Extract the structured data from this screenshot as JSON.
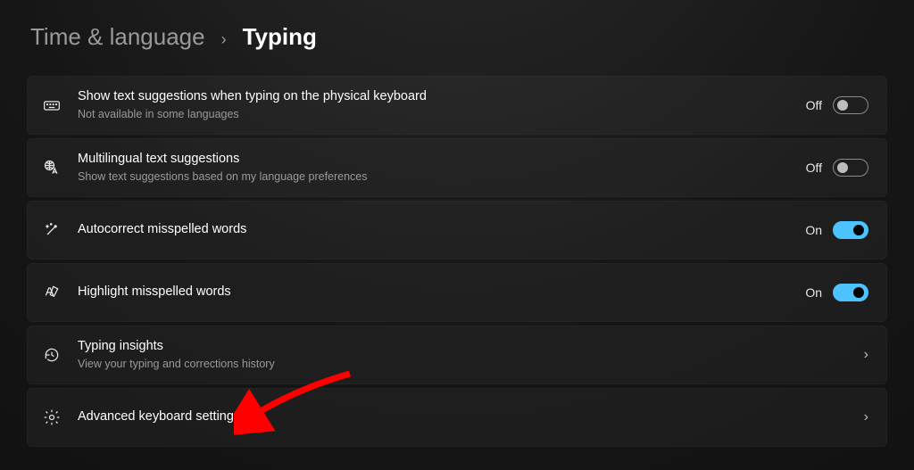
{
  "breadcrumb": {
    "parent": "Time & language",
    "current": "Typing"
  },
  "toggle_labels": {
    "on": "On",
    "off": "Off"
  },
  "rows": [
    {
      "icon": "keyboard-icon",
      "title": "Show text suggestions when typing on the physical keyboard",
      "sub": "Not available in some languages",
      "kind": "toggle",
      "state": "off"
    },
    {
      "icon": "globe-translate-icon",
      "title": "Multilingual text suggestions",
      "sub": "Show text suggestions based on my language preferences",
      "kind": "toggle",
      "state": "off"
    },
    {
      "icon": "wand-icon",
      "title": "Autocorrect misspelled words",
      "kind": "toggle",
      "state": "on"
    },
    {
      "icon": "highlight-icon",
      "title": "Highlight misspelled words",
      "kind": "toggle",
      "state": "on"
    },
    {
      "icon": "history-icon",
      "title": "Typing insights",
      "sub": "View your typing and corrections history",
      "kind": "nav"
    },
    {
      "icon": "gear-icon",
      "title": "Advanced keyboard settings",
      "kind": "nav"
    }
  ],
  "colors": {
    "accent": "#4cc2ff",
    "annotation": "#ff0000"
  }
}
